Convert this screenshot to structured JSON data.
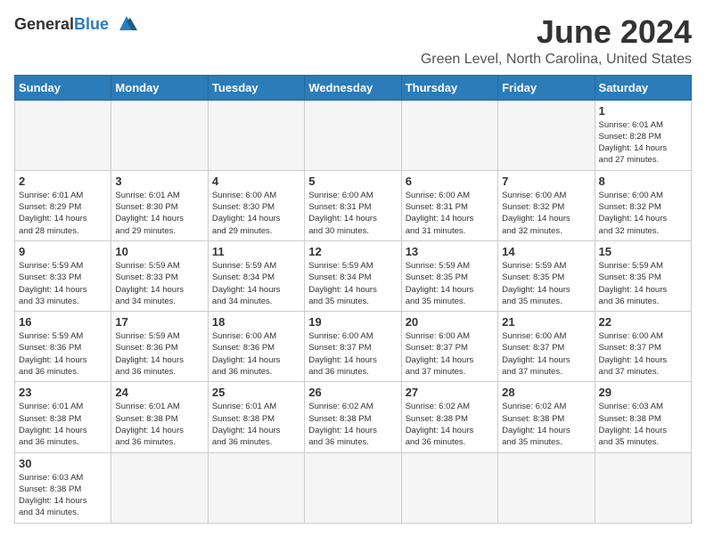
{
  "header": {
    "logo_line1": "General",
    "logo_line2": "Blue",
    "month": "June 2024",
    "location": "Green Level, North Carolina, United States"
  },
  "weekdays": [
    "Sunday",
    "Monday",
    "Tuesday",
    "Wednesday",
    "Thursday",
    "Friday",
    "Saturday"
  ],
  "weeks": [
    [
      {
        "day": "",
        "info": ""
      },
      {
        "day": "",
        "info": ""
      },
      {
        "day": "",
        "info": ""
      },
      {
        "day": "",
        "info": ""
      },
      {
        "day": "",
        "info": ""
      },
      {
        "day": "",
        "info": ""
      },
      {
        "day": "1",
        "info": "Sunrise: 6:01 AM\nSunset: 8:28 PM\nDaylight: 14 hours\nand 27 minutes."
      }
    ],
    [
      {
        "day": "2",
        "info": "Sunrise: 6:01 AM\nSunset: 8:29 PM\nDaylight: 14 hours\nand 28 minutes."
      },
      {
        "day": "3",
        "info": "Sunrise: 6:01 AM\nSunset: 8:30 PM\nDaylight: 14 hours\nand 29 minutes."
      },
      {
        "day": "4",
        "info": "Sunrise: 6:00 AM\nSunset: 8:30 PM\nDaylight: 14 hours\nand 29 minutes."
      },
      {
        "day": "5",
        "info": "Sunrise: 6:00 AM\nSunset: 8:31 PM\nDaylight: 14 hours\nand 30 minutes."
      },
      {
        "day": "6",
        "info": "Sunrise: 6:00 AM\nSunset: 8:31 PM\nDaylight: 14 hours\nand 31 minutes."
      },
      {
        "day": "7",
        "info": "Sunrise: 6:00 AM\nSunset: 8:32 PM\nDaylight: 14 hours\nand 32 minutes."
      },
      {
        "day": "8",
        "info": "Sunrise: 6:00 AM\nSunset: 8:32 PM\nDaylight: 14 hours\nand 32 minutes."
      }
    ],
    [
      {
        "day": "9",
        "info": "Sunrise: 5:59 AM\nSunset: 8:33 PM\nDaylight: 14 hours\nand 33 minutes."
      },
      {
        "day": "10",
        "info": "Sunrise: 5:59 AM\nSunset: 8:33 PM\nDaylight: 14 hours\nand 34 minutes."
      },
      {
        "day": "11",
        "info": "Sunrise: 5:59 AM\nSunset: 8:34 PM\nDaylight: 14 hours\nand 34 minutes."
      },
      {
        "day": "12",
        "info": "Sunrise: 5:59 AM\nSunset: 8:34 PM\nDaylight: 14 hours\nand 35 minutes."
      },
      {
        "day": "13",
        "info": "Sunrise: 5:59 AM\nSunset: 8:35 PM\nDaylight: 14 hours\nand 35 minutes."
      },
      {
        "day": "14",
        "info": "Sunrise: 5:59 AM\nSunset: 8:35 PM\nDaylight: 14 hours\nand 35 minutes."
      },
      {
        "day": "15",
        "info": "Sunrise: 5:59 AM\nSunset: 8:35 PM\nDaylight: 14 hours\nand 36 minutes."
      }
    ],
    [
      {
        "day": "16",
        "info": "Sunrise: 5:59 AM\nSunset: 8:36 PM\nDaylight: 14 hours\nand 36 minutes."
      },
      {
        "day": "17",
        "info": "Sunrise: 5:59 AM\nSunset: 8:36 PM\nDaylight: 14 hours\nand 36 minutes."
      },
      {
        "day": "18",
        "info": "Sunrise: 6:00 AM\nSunset: 8:36 PM\nDaylight: 14 hours\nand 36 minutes."
      },
      {
        "day": "19",
        "info": "Sunrise: 6:00 AM\nSunset: 8:37 PM\nDaylight: 14 hours\nand 36 minutes."
      },
      {
        "day": "20",
        "info": "Sunrise: 6:00 AM\nSunset: 8:37 PM\nDaylight: 14 hours\nand 37 minutes."
      },
      {
        "day": "21",
        "info": "Sunrise: 6:00 AM\nSunset: 8:37 PM\nDaylight: 14 hours\nand 37 minutes."
      },
      {
        "day": "22",
        "info": "Sunrise: 6:00 AM\nSunset: 8:37 PM\nDaylight: 14 hours\nand 37 minutes."
      }
    ],
    [
      {
        "day": "23",
        "info": "Sunrise: 6:01 AM\nSunset: 8:38 PM\nDaylight: 14 hours\nand 36 minutes."
      },
      {
        "day": "24",
        "info": "Sunrise: 6:01 AM\nSunset: 8:38 PM\nDaylight: 14 hours\nand 36 minutes."
      },
      {
        "day": "25",
        "info": "Sunrise: 6:01 AM\nSunset: 8:38 PM\nDaylight: 14 hours\nand 36 minutes."
      },
      {
        "day": "26",
        "info": "Sunrise: 6:02 AM\nSunset: 8:38 PM\nDaylight: 14 hours\nand 36 minutes."
      },
      {
        "day": "27",
        "info": "Sunrise: 6:02 AM\nSunset: 8:38 PM\nDaylight: 14 hours\nand 36 minutes."
      },
      {
        "day": "28",
        "info": "Sunrise: 6:02 AM\nSunset: 8:38 PM\nDaylight: 14 hours\nand 35 minutes."
      },
      {
        "day": "29",
        "info": "Sunrise: 6:03 AM\nSunset: 8:38 PM\nDaylight: 14 hours\nand 35 minutes."
      }
    ],
    [
      {
        "day": "30",
        "info": "Sunrise: 6:03 AM\nSunset: 8:38 PM\nDaylight: 14 hours\nand 34 minutes."
      },
      {
        "day": "",
        "info": ""
      },
      {
        "day": "",
        "info": ""
      },
      {
        "day": "",
        "info": ""
      },
      {
        "day": "",
        "info": ""
      },
      {
        "day": "",
        "info": ""
      },
      {
        "day": "",
        "info": ""
      }
    ]
  ]
}
